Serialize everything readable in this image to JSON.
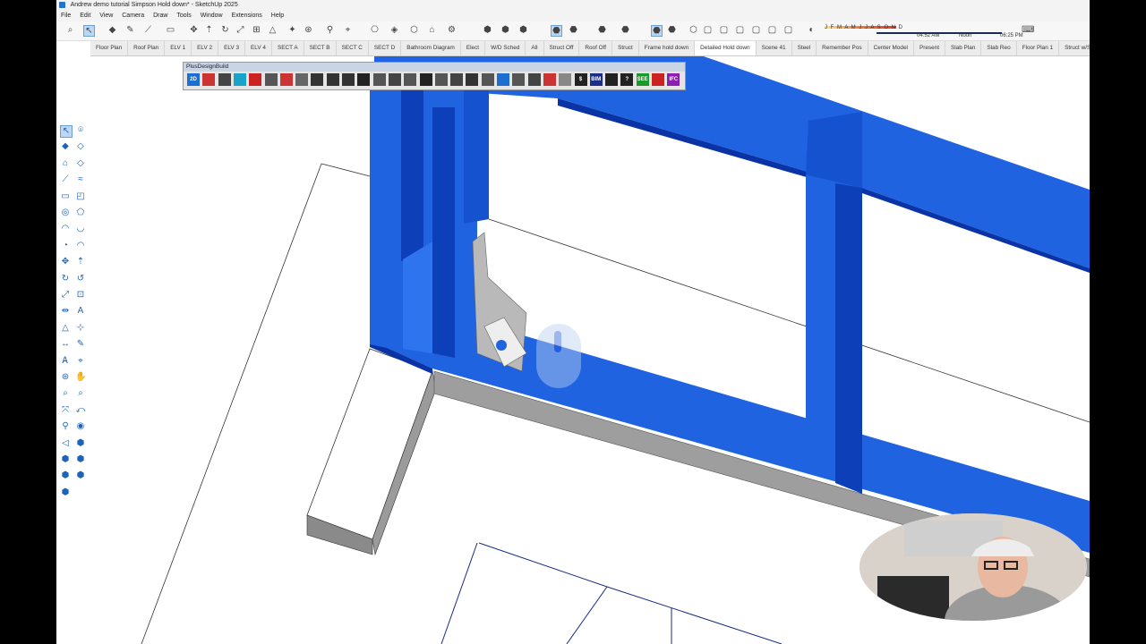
{
  "window": {
    "title": "Andrew demo tutorial Simpson Hold down* - SketchUp 2025"
  },
  "menu": [
    "File",
    "Edit",
    "View",
    "Camera",
    "Draw",
    "Tools",
    "Window",
    "Extensions",
    "Help"
  ],
  "shadow": {
    "months": "J F M A M J J A S O N D",
    "time_start": "04:52 AM",
    "time_mid": "Noon",
    "time_end": "06:25 PM"
  },
  "tabs": [
    "Floor Plan",
    "Roof Plan",
    "ELV 1",
    "ELV 2",
    "ELV 3",
    "ELV 4",
    "SECT A",
    "SECT B",
    "SECT C",
    "SECT D",
    "Bathroom Diagram",
    "Elect",
    "W/D Sched",
    "All",
    "Struct Off",
    "Roof Off",
    "Struct",
    "Frame hold down",
    "Detailed Hold down",
    "Scene 41",
    "Steel",
    "Remember Pos",
    "Center Model",
    "Present",
    "Slab Plan",
    "Slab Reo",
    "Floor Plan 1",
    "Struct w/Sh"
  ],
  "active_tab": "Detailed Hold down",
  "plusdesign": {
    "title": "PlusDesignBuild",
    "icons": [
      "2D",
      "",
      "",
      "",
      "",
      "",
      "",
      "",
      "",
      "",
      "",
      "",
      "",
      "",
      "",
      "",
      "",
      "",
      "",
      "",
      "",
      "",
      "",
      "",
      "",
      "$",
      "BIM",
      "",
      "?",
      "SEE",
      "",
      "IFC"
    ]
  },
  "colors": {
    "stud": "#1f63e0",
    "stud_dark": "#0d3fb8",
    "stud_side": "#0a34a5",
    "slab": "#a8a8a8",
    "bracket": "#b9b9b9"
  }
}
